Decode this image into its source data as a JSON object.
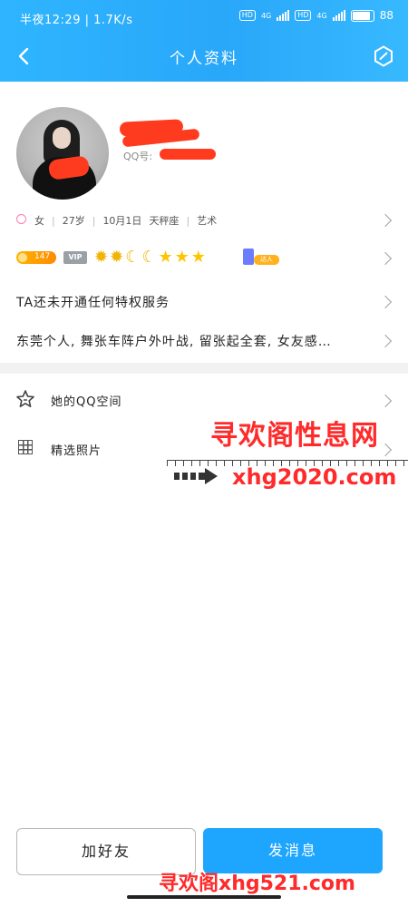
{
  "status_bar": {
    "time_speed": "半夜12:29 | 1.7K/s",
    "net1": "4G",
    "net2": "4G",
    "battery": "88"
  },
  "header": {
    "title": "个人资料"
  },
  "profile": {
    "qq_label": "QQ号:"
  },
  "info": {
    "gender": "女",
    "age": "27岁",
    "birthday": "10月1日",
    "zodiac": "天秤座",
    "job": "艺术"
  },
  "level": {
    "lv_value": "147",
    "vip_label": "VIP",
    "nameplate_tag": "达人"
  },
  "privilege": {
    "text": "TA还未开通任何特权服务"
  },
  "signature": {
    "text": "东莞个人, 舞张车阵户外叶战, 留张起全套, 女友感…"
  },
  "menu": {
    "space_label": "她的QQ空间",
    "photos_label": "精选照片"
  },
  "watermarks": {
    "site_name": "寻欢阁性息网",
    "site_url": "xhg2020.com",
    "footer": "寻欢阁xhg521.com"
  },
  "actions": {
    "add_friend": "加好友",
    "send_message": "发消息"
  },
  "colors": {
    "header_blue": "#29a7f9",
    "primary_button": "#1ea6ff",
    "redact_red": "#ff3b1f",
    "watermark_red": "#ff2a2a"
  }
}
